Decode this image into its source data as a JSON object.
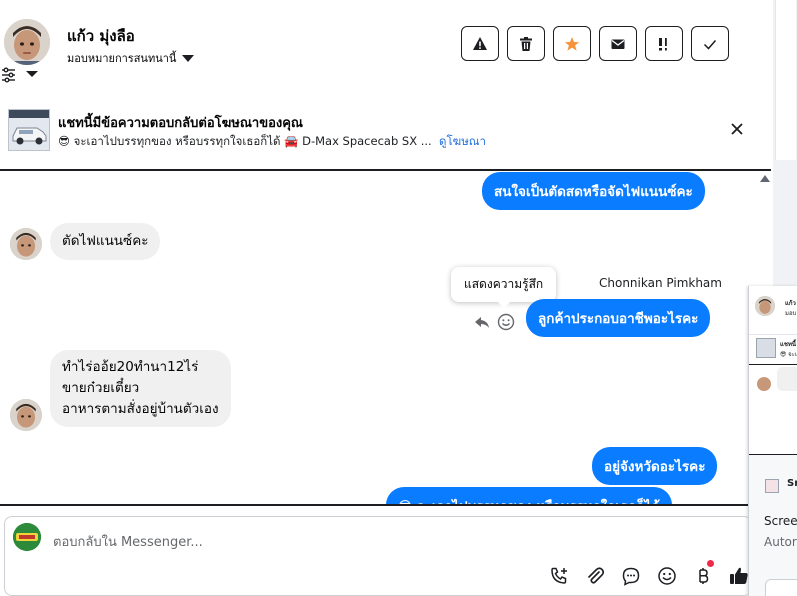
{
  "header": {
    "name": "แก้ว มุ่งลือ",
    "assign_label": "มอบหมายการสนทนานี้",
    "actions": [
      "warning-icon",
      "trash-icon",
      "star-icon",
      "envelope-icon",
      "important-icon",
      "check-icon"
    ]
  },
  "ad": {
    "title": "แชทนี้มีข้อความตอบกลับต่อโฆษณาของคุณ",
    "subtitle": "😎 จะเอาไปบรรทุกของ หรือบรรทุกใจเธอก็ได้ 🚘 D-Max Spacecab SX ...",
    "link": "ดูโฆษณา"
  },
  "messages": [
    {
      "dir": "out",
      "text": "สนใจเป็นตัดสดหรือจัดไฟแนนซ์คะ"
    },
    {
      "dir": "in",
      "text": "ตัดไฟแนนซ์คะ"
    },
    {
      "dir": "out",
      "sender": "Chonnikan Pimkham",
      "text": "ลูกค้าประกอบอาชีพอะไรคะ"
    },
    {
      "dir": "in",
      "lines": [
        "ทำไร่ออ้ย20ทำนา12ไร่",
        "ขายก๋วยเตี๋ยว",
        "อาหารตามสั่งอยู่บ้านตัวเอง"
      ]
    },
    {
      "dir": "out",
      "text": "อยู่จังหวัดอะไรคะ"
    },
    {
      "dir": "out",
      "text": "😎 จะเอาไปบรรทุกของ หรือบรรทุกใจเธอก็ได้"
    }
  ],
  "tooltip": "แสดงความรู้สึก",
  "composer": {
    "placeholder": "ตอบกลับใน Messenger...",
    "tools": [
      "call-add-icon",
      "attach-icon",
      "saved-reply-icon",
      "emoji-icon",
      "baht-icon",
      "like-icon"
    ]
  },
  "mini": {
    "name": "แก้ว",
    "line2": "มอบ",
    "ad": "แชทนี้",
    "ad2": "😎 จะเ",
    "screen": "Scree",
    "auto": "Autor",
    "sn": "Sn"
  },
  "colors": {
    "brand_blue": "#0a7cff",
    "link": "#216fdb",
    "star": "#f7923a"
  }
}
